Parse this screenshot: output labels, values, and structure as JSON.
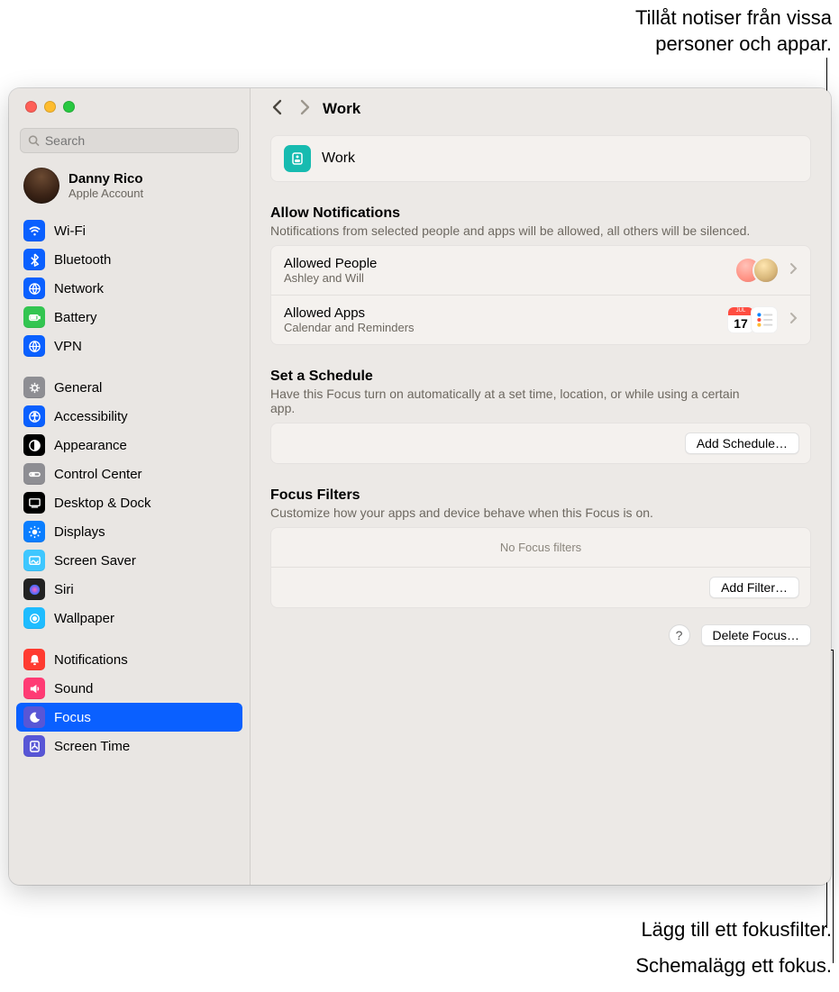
{
  "callouts": {
    "allow": "Tillåt notiser från vissa\npersoner och appar.",
    "filter": "Lägg till ett fokusfilter.",
    "schedule": "Schemalägg ett fokus."
  },
  "search": {
    "placeholder": "Search"
  },
  "account": {
    "name": "Danny Rico",
    "sub": "Apple Account"
  },
  "sidebar": {
    "g1": [
      {
        "label": "Wi-Fi",
        "color": "#0a60ff"
      },
      {
        "label": "Bluetooth",
        "color": "#0a60ff"
      },
      {
        "label": "Network",
        "color": "#0a60ff"
      },
      {
        "label": "Battery",
        "color": "#33c551"
      },
      {
        "label": "VPN",
        "color": "#0a60ff"
      }
    ],
    "g2": [
      {
        "label": "General",
        "color": "#8e8e93"
      },
      {
        "label": "Accessibility",
        "color": "#0a60ff"
      },
      {
        "label": "Appearance",
        "color": "#000000"
      },
      {
        "label": "Control Center",
        "color": "#8e8e93"
      },
      {
        "label": "Desktop & Dock",
        "color": "#000000"
      },
      {
        "label": "Displays",
        "color": "#0a7eff"
      },
      {
        "label": "Screen Saver",
        "color": "#3ec7ff"
      },
      {
        "label": "Siri",
        "color": "#222222"
      },
      {
        "label": "Wallpaper",
        "color": "#1fbcff"
      }
    ],
    "g3": [
      {
        "label": "Notifications",
        "color": "#ff3b30"
      },
      {
        "label": "Sound",
        "color": "#ff3b74"
      },
      {
        "label": "Focus",
        "color": "#5856d6",
        "selected": true
      },
      {
        "label": "Screen Time",
        "color": "#5856d6"
      }
    ]
  },
  "crumb": {
    "title": "Work"
  },
  "work": {
    "title": "Work"
  },
  "allow": {
    "heading": "Allow Notifications",
    "sub": "Notifications from selected people and apps will be allowed, all others will be silenced.",
    "people": {
      "title": "Allowed People",
      "sub": "Ashley and Will"
    },
    "apps": {
      "title": "Allowed Apps",
      "sub": "Calendar and Reminders",
      "cal_day": "17",
      "cal_top": "JUL"
    }
  },
  "schedule": {
    "heading": "Set a Schedule",
    "sub": "Have this Focus turn on automatically at a set time, location, or while using a certain app.",
    "button": "Add Schedule…"
  },
  "filters": {
    "heading": "Focus Filters",
    "sub": "Customize how your apps and device behave when this Focus is on.",
    "empty": "No Focus filters",
    "button": "Add Filter…"
  },
  "footer": {
    "delete": "Delete Focus…",
    "help": "?"
  }
}
